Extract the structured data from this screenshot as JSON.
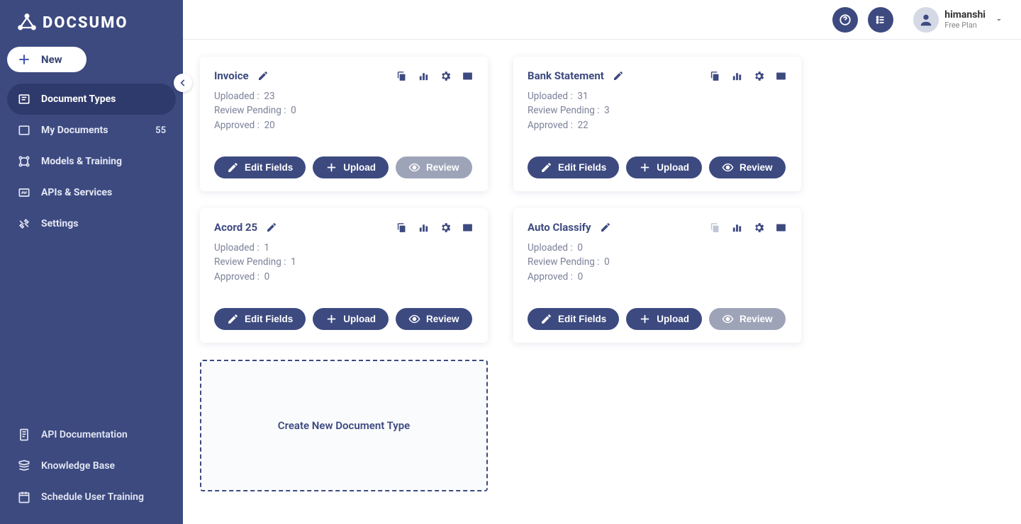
{
  "brand": "DOCSUMO",
  "new_button": "New",
  "sidebar": {
    "items": [
      {
        "label": "Document Types"
      },
      {
        "label": "My Documents",
        "count": "55"
      },
      {
        "label": "Models & Training"
      },
      {
        "label": "APIs & Services"
      },
      {
        "label": "Settings"
      }
    ],
    "bottom": [
      {
        "label": "API Documentation"
      },
      {
        "label": "Knowledge Base"
      },
      {
        "label": "Schedule User Training"
      }
    ]
  },
  "user": {
    "name": "himanshi",
    "plan": "Free Plan"
  },
  "labels": {
    "uploaded": "Uploaded :",
    "pending": "Review Pending :",
    "approved": "Approved :",
    "edit_fields": "Edit Fields",
    "upload": "Upload",
    "review": "Review",
    "create_new": "Create New Document Type"
  },
  "cards": [
    {
      "title": "Invoice",
      "uploaded": "23",
      "pending": "0",
      "approved": "20",
      "review_gray": true,
      "copy_dim": false
    },
    {
      "title": "Bank Statement",
      "uploaded": "31",
      "pending": "3",
      "approved": "22",
      "review_gray": false,
      "copy_dim": false
    },
    {
      "title": "Acord 25",
      "uploaded": "1",
      "pending": "1",
      "approved": "0",
      "review_gray": false,
      "copy_dim": false
    },
    {
      "title": "Auto Classify",
      "uploaded": "0",
      "pending": "0",
      "approved": "0",
      "review_gray": true,
      "copy_dim": true
    }
  ]
}
